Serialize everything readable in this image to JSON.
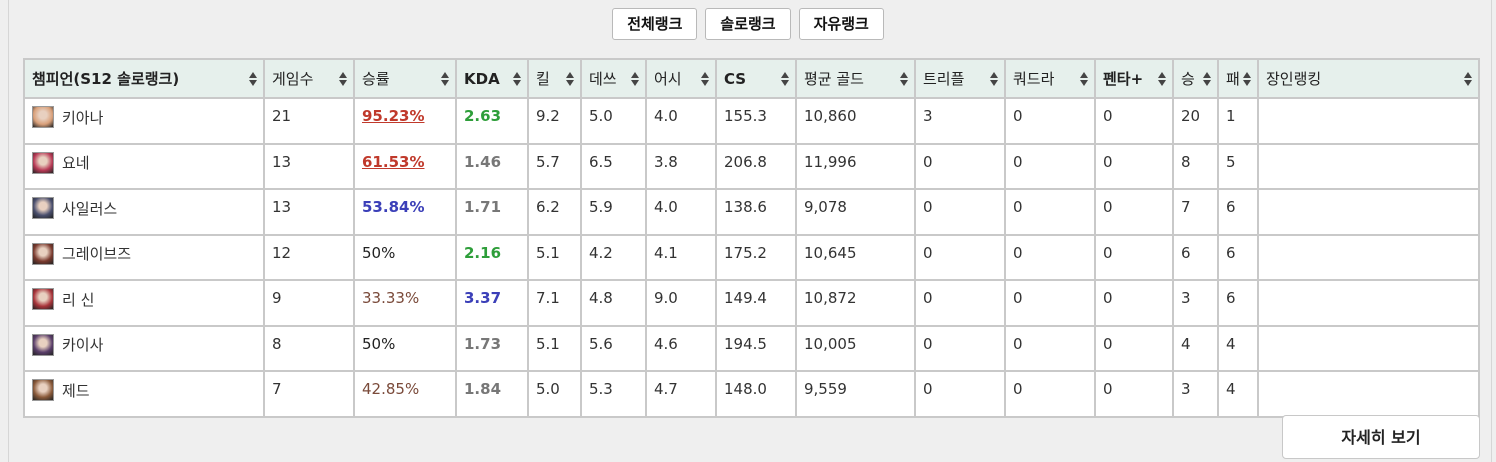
{
  "tabs": [
    "전체랭크",
    "솔로랭크",
    "자유랭크"
  ],
  "columns": [
    "챔피언(S12 솔로랭크)",
    "게임수",
    "승률",
    "KDA",
    "킬",
    "데쓰",
    "어시",
    "CS",
    "평균 골드",
    "트리플",
    "쿼드라",
    "펜타+",
    "승",
    "패",
    "장인랭킹"
  ],
  "rows": [
    {
      "champion": "키아나",
      "games": "21",
      "winrate": "95.23%",
      "kda": "2.63",
      "kills": "9.2",
      "deaths": "5.0",
      "assists": "4.0",
      "cs": "155.3",
      "gold": "10,860",
      "triple": "3",
      "quadra": "0",
      "penta": "0",
      "wins": "20",
      "losses": "1",
      "mastery": "",
      "winrate_style": "rate-high",
      "kda_style": "kda-good",
      "avatar_color": "#d9a07a"
    },
    {
      "champion": "요네",
      "games": "13",
      "winrate": "61.53%",
      "kda": "1.46",
      "kills": "5.7",
      "deaths": "6.5",
      "assists": "3.8",
      "cs": "206.8",
      "gold": "11,996",
      "triple": "0",
      "quadra": "0",
      "penta": "0",
      "wins": "8",
      "losses": "5",
      "mastery": "",
      "winrate_style": "rate-high",
      "kda_style": "kda-normal",
      "avatar_color": "#b83a56"
    },
    {
      "champion": "사일러스",
      "games": "13",
      "winrate": "53.84%",
      "kda": "1.71",
      "kills": "6.2",
      "deaths": "5.9",
      "assists": "4.0",
      "cs": "138.6",
      "gold": "9,078",
      "triple": "0",
      "quadra": "0",
      "penta": "0",
      "wins": "7",
      "losses": "6",
      "mastery": "",
      "winrate_style": "rate-mid",
      "kda_style": "kda-normal",
      "avatar_color": "#4a4f6e"
    },
    {
      "champion": "그레이브즈",
      "games": "12",
      "winrate": "50%",
      "kda": "2.16",
      "kills": "5.1",
      "deaths": "4.2",
      "assists": "4.1",
      "cs": "175.2",
      "gold": "10,645",
      "triple": "0",
      "quadra": "0",
      "penta": "0",
      "wins": "6",
      "losses": "6",
      "mastery": "",
      "winrate_style": "rate-50",
      "kda_style": "kda-good",
      "avatar_color": "#7a3a2e"
    },
    {
      "champion": "리 신",
      "games": "9",
      "winrate": "33.33%",
      "kda": "3.37",
      "kills": "7.1",
      "deaths": "4.8",
      "assists": "9.0",
      "cs": "149.4",
      "gold": "10,872",
      "triple": "0",
      "quadra": "0",
      "penta": "0",
      "wins": "3",
      "losses": "6",
      "mastery": "",
      "winrate_style": "rate-low",
      "kda_style": "kda-great",
      "avatar_color": "#a8343a"
    },
    {
      "champion": "카이사",
      "games": "8",
      "winrate": "50%",
      "kda": "1.73",
      "kills": "5.1",
      "deaths": "5.6",
      "assists": "4.6",
      "cs": "194.5",
      "gold": "10,005",
      "triple": "0",
      "quadra": "0",
      "penta": "0",
      "wins": "4",
      "losses": "4",
      "mastery": "",
      "winrate_style": "rate-50",
      "kda_style": "kda-normal",
      "avatar_color": "#5a3e6a"
    },
    {
      "champion": "제드",
      "games": "7",
      "winrate": "42.85%",
      "kda": "1.84",
      "kills": "5.0",
      "deaths": "5.3",
      "assists": "4.7",
      "cs": "148.0",
      "gold": "9,559",
      "triple": "0",
      "quadra": "0",
      "penta": "0",
      "wins": "3",
      "losses": "4",
      "mastery": "",
      "winrate_style": "rate-low",
      "kda_style": "kda-normal",
      "avatar_color": "#8a5a3a"
    }
  ],
  "more_button": "자세히 보기"
}
